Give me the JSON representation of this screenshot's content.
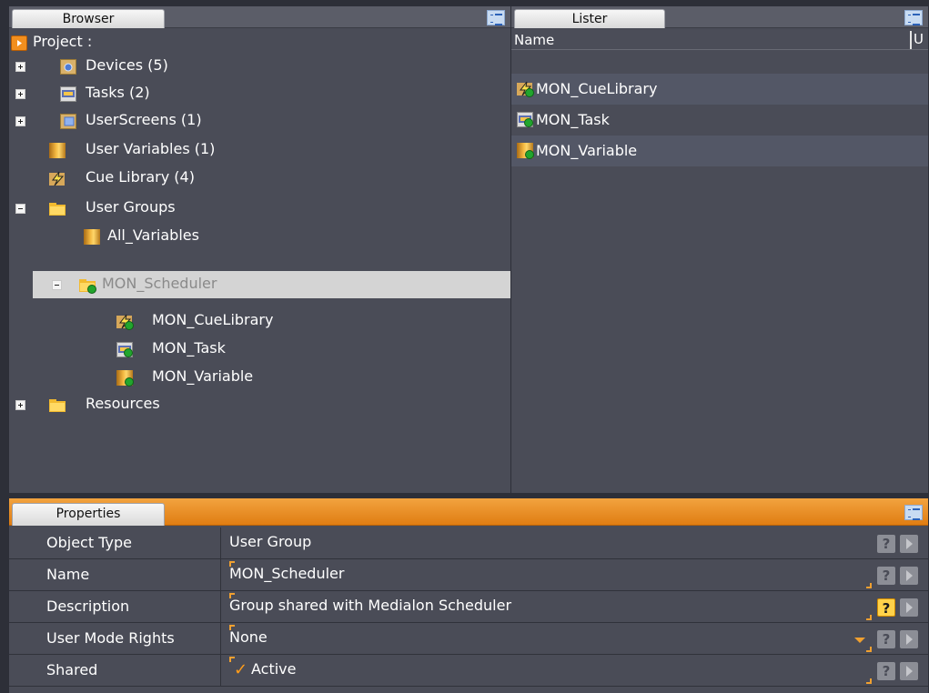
{
  "browser": {
    "tab_label": "Browser",
    "project_label": "Project :",
    "items": [
      {
        "label": "Devices (5)",
        "icon": "devices-icon"
      },
      {
        "label": "Tasks (2)",
        "icon": "tasks-icon"
      },
      {
        "label": "UserScreens (1)",
        "icon": "userscreens-icon"
      },
      {
        "label": "User Variables (1)",
        "icon": "user-variables-icon"
      },
      {
        "label": "Cue Library (4)",
        "icon": "cue-library-icon"
      },
      {
        "label": "User Groups",
        "icon": "folder-icon"
      },
      {
        "label": "All_Variables",
        "icon": "variables-group-icon"
      },
      {
        "label": "MON_Scheduler",
        "icon": "shared-folder-icon"
      },
      {
        "label": "MON_CueLibrary",
        "icon": "cue-library-shared-icon"
      },
      {
        "label": "MON_Task",
        "icon": "task-shared-icon"
      },
      {
        "label": "MON_Variable",
        "icon": "variable-shared-icon"
      },
      {
        "label": "Resources",
        "icon": "folder-icon"
      }
    ]
  },
  "lister": {
    "tab_label": "Lister",
    "columns": {
      "name": "Name",
      "u": "U"
    },
    "items": [
      {
        "label": "MON_CueLibrary",
        "icon": "cue-library-shared-icon"
      },
      {
        "label": "MON_Task",
        "icon": "task-shared-icon"
      },
      {
        "label": "MON_Variable",
        "icon": "variable-shared-icon"
      }
    ]
  },
  "properties": {
    "tab_label": "Properties",
    "rows": [
      {
        "name": "Object Type",
        "value": "User Group"
      },
      {
        "name": "Name",
        "value": "MON_Scheduler"
      },
      {
        "name": "Description",
        "value": "Group shared with Medialon Scheduler"
      },
      {
        "name": "User Mode Rights",
        "value": "None"
      },
      {
        "name": "Shared",
        "value": "Active"
      }
    ],
    "help_glyph": "?",
    "check_glyph": "✓"
  },
  "colors": {
    "background": "#4a4c57",
    "accent_orange": "#e6891a",
    "selection": "#d4d4d4"
  }
}
